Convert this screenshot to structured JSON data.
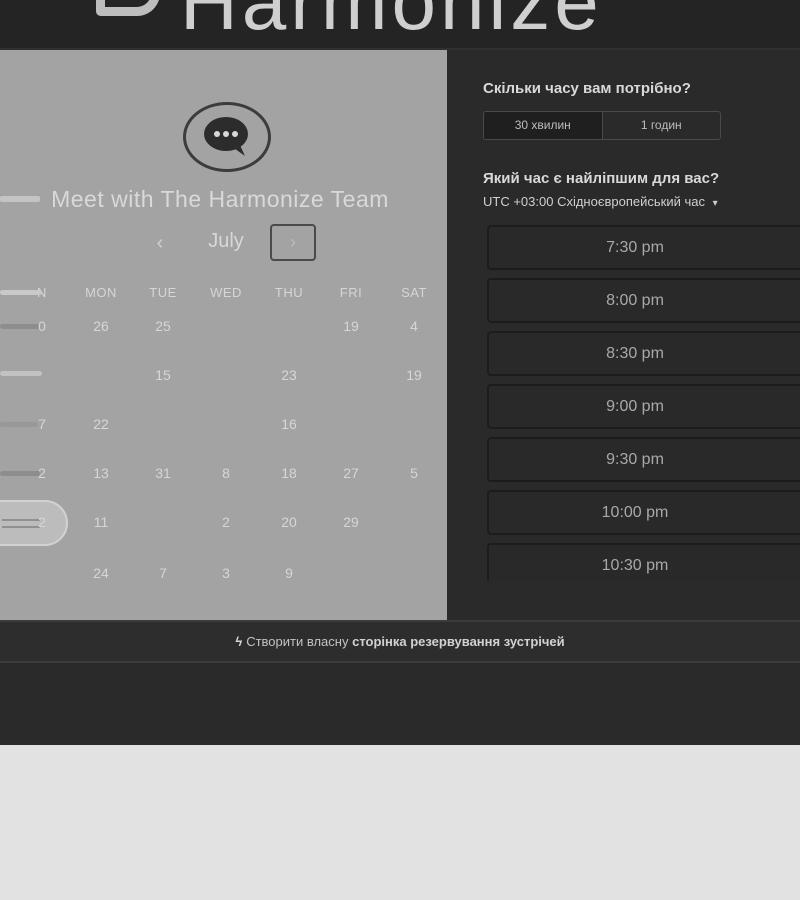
{
  "brand": {
    "name": "Harmonize"
  },
  "meeting": {
    "title": "Meet with The Harmonize Team"
  },
  "calendar": {
    "month": "July",
    "prev_symbol": "‹",
    "next_symbol": "›",
    "weekdays": [
      "N",
      "MON",
      "TUE",
      "WED",
      "THU",
      "FRI",
      "SAT"
    ],
    "rows": [
      [
        "0",
        "26",
        "25",
        "",
        "",
        "19",
        "4"
      ],
      [
        "",
        "",
        "15",
        "",
        "23",
        "",
        "19"
      ],
      [
        "7",
        "22",
        "",
        "",
        "16",
        "",
        ""
      ],
      [
        "2",
        "13",
        "31",
        "8",
        "18",
        "27",
        "5"
      ],
      [
        "2",
        "11",
        "",
        "2",
        "20",
        "29",
        ""
      ],
      [
        "",
        "24",
        "7",
        "3",
        "9",
        "",
        ""
      ]
    ]
  },
  "duration": {
    "question": "Скільки часу вам потрібно?",
    "options": [
      "30 хвилин",
      "1 годин"
    ]
  },
  "time": {
    "question": "Який час є найліпшим для вас?",
    "timezone": "UTC +03:00 Східноєвропейський час",
    "slots": [
      "7:30 pm",
      "8:00 pm",
      "8:30 pm",
      "9:00 pm",
      "9:30 pm",
      "10:00 pm",
      "10:30 pm"
    ]
  },
  "footer": {
    "prefix": "Створити власну",
    "link": "сторінка резервування зустрічей"
  },
  "colors": {
    "panel_left": "#a3a3a3",
    "panel_right": "#2a2a2a",
    "page_bg": "#e2e2e2"
  }
}
